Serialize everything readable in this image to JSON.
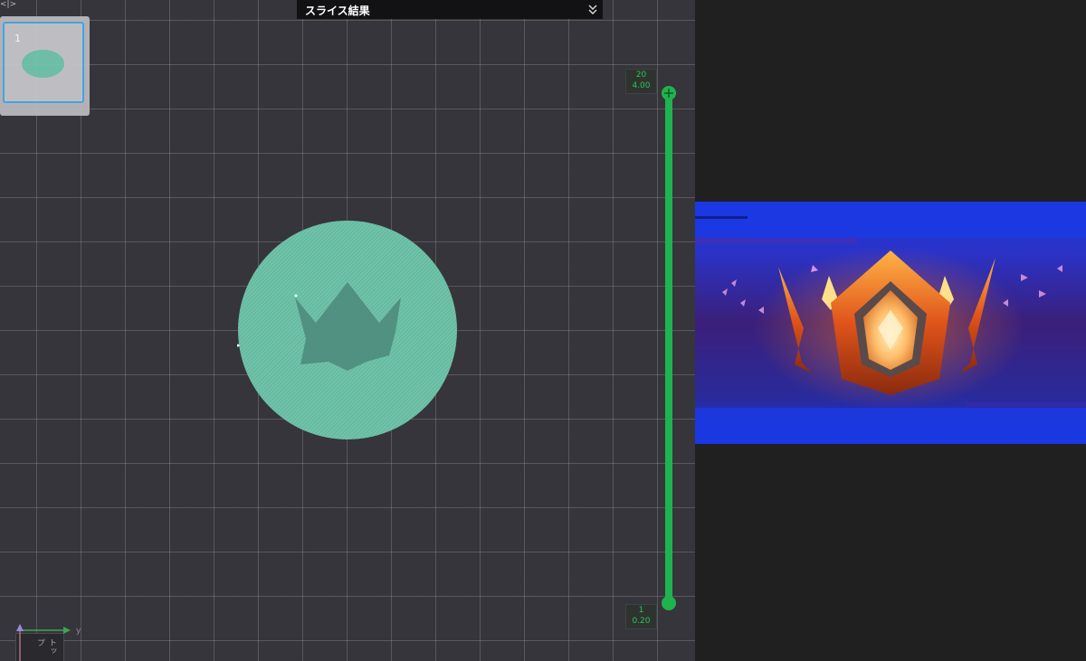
{
  "panel": {
    "title": "スライス結果",
    "collapse_icon": "double-chevron-down-icon"
  },
  "thumbnail": {
    "index": "1",
    "shape": "green-oval"
  },
  "slider": {
    "top_layer": "20",
    "top_height": "4.00",
    "bottom_layer": "1",
    "bottom_height": "0.20",
    "accent_color": "#1fb34f"
  },
  "model": {
    "color": "#72c5ab",
    "emblem": "crown-cutout"
  },
  "axis": {
    "y_label": "y",
    "view_label": "トップ"
  },
  "preview": {
    "subject": "crown-badge-banner"
  }
}
